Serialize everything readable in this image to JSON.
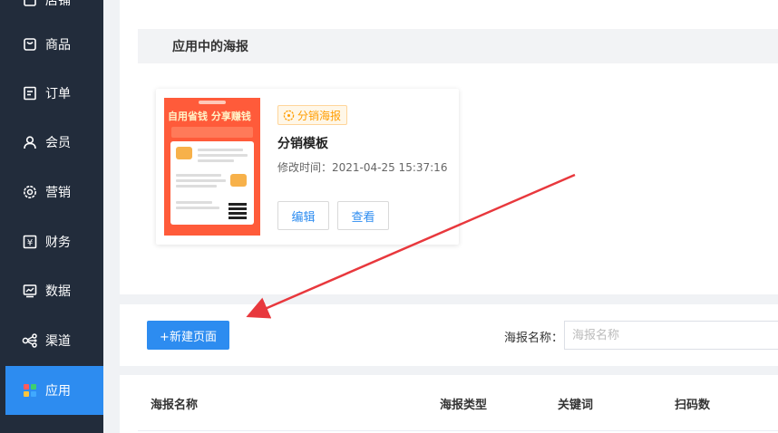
{
  "sidebar": {
    "items": [
      {
        "label": "店铺",
        "icon": "shop-icon"
      },
      {
        "label": "商品",
        "icon": "bag-icon"
      },
      {
        "label": "订单",
        "icon": "order-icon"
      },
      {
        "label": "会员",
        "icon": "user-icon"
      },
      {
        "label": "营销",
        "icon": "marketing-icon"
      },
      {
        "label": "财务",
        "icon": "yen-icon"
      },
      {
        "label": "数据",
        "icon": "chart-icon"
      },
      {
        "label": "渠道",
        "icon": "share-icon"
      },
      {
        "label": "应用",
        "icon": "apps-icon"
      }
    ],
    "active_index": 8
  },
  "section": {
    "title": "应用中的海报"
  },
  "poster_card": {
    "thumb_title": "自用省钱 分享赚钱",
    "badge": "分销海报",
    "name": "分销模板",
    "modified": "修改时间：2021-04-25 15:37:16",
    "edit_label": "编辑",
    "view_label": "查看"
  },
  "toolbar": {
    "new_page_label": "+新建页面",
    "search_label": "海报名称：",
    "search_placeholder": "海报名称"
  },
  "table": {
    "columns": [
      "海报名称",
      "海报类型",
      "关键词",
      "扫码数"
    ]
  },
  "colors": {
    "sidebar_bg": "#222c3b",
    "accent": "#2d8cf0",
    "badge": "#ff9d00",
    "arrow": "#e8383d"
  }
}
